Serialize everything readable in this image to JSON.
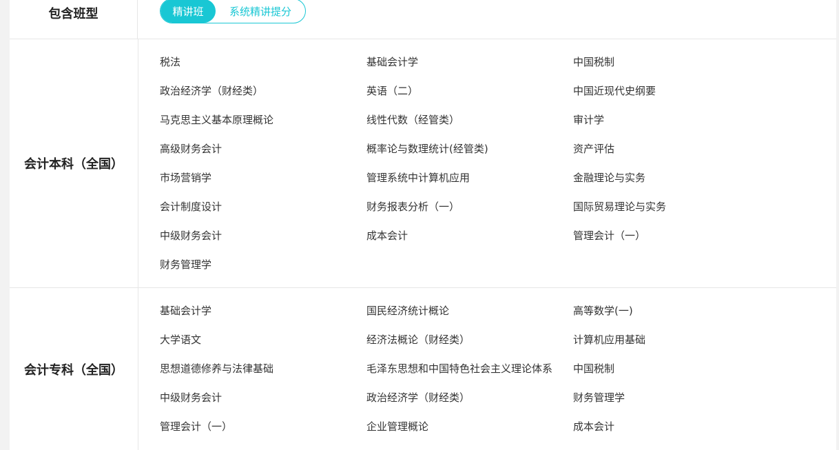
{
  "class_types": {
    "label": "包含班型",
    "tabs": [
      {
        "label": "精讲班",
        "active": true
      },
      {
        "label": "系统精讲提分",
        "active": false
      }
    ]
  },
  "sections": [
    {
      "title": "会计本科（全国）",
      "courses": [
        "税法",
        "基础会计学",
        "中国税制",
        "政治经济学（财经类）",
        "英语（二）",
        "中国近现代史纲要",
        "马克思主义基本原理概论",
        "线性代数（经管类）",
        "审计学",
        "高级财务会计",
        "概率论与数理统计(经管类)",
        "资产评估",
        "市场营销学",
        "管理系统中计算机应用",
        "金融理论与实务",
        "会计制度设计",
        "财务报表分析（一）",
        "国际贸易理论与实务",
        "中级财务会计",
        "成本会计",
        "管理会计（一）",
        "财务管理学"
      ]
    },
    {
      "title": "会计专科（全国）",
      "courses": [
        "基础会计学",
        "国民经济统计概论",
        "高等数学(一)",
        "大学语文",
        "经济法概论（财经类）",
        "计算机应用基础",
        "思想道德修养与法律基础",
        "毛泽东思想和中国特色社会主义理论体系",
        "中国税制",
        "中级财务会计",
        "政治经济学（财经类）",
        "财务管理学",
        "管理会计（一）",
        "企业管理概论",
        "成本会计"
      ]
    }
  ],
  "colors": {
    "accent": "#19c7d4",
    "text": "#333333",
    "border": "#e6e6e6"
  }
}
